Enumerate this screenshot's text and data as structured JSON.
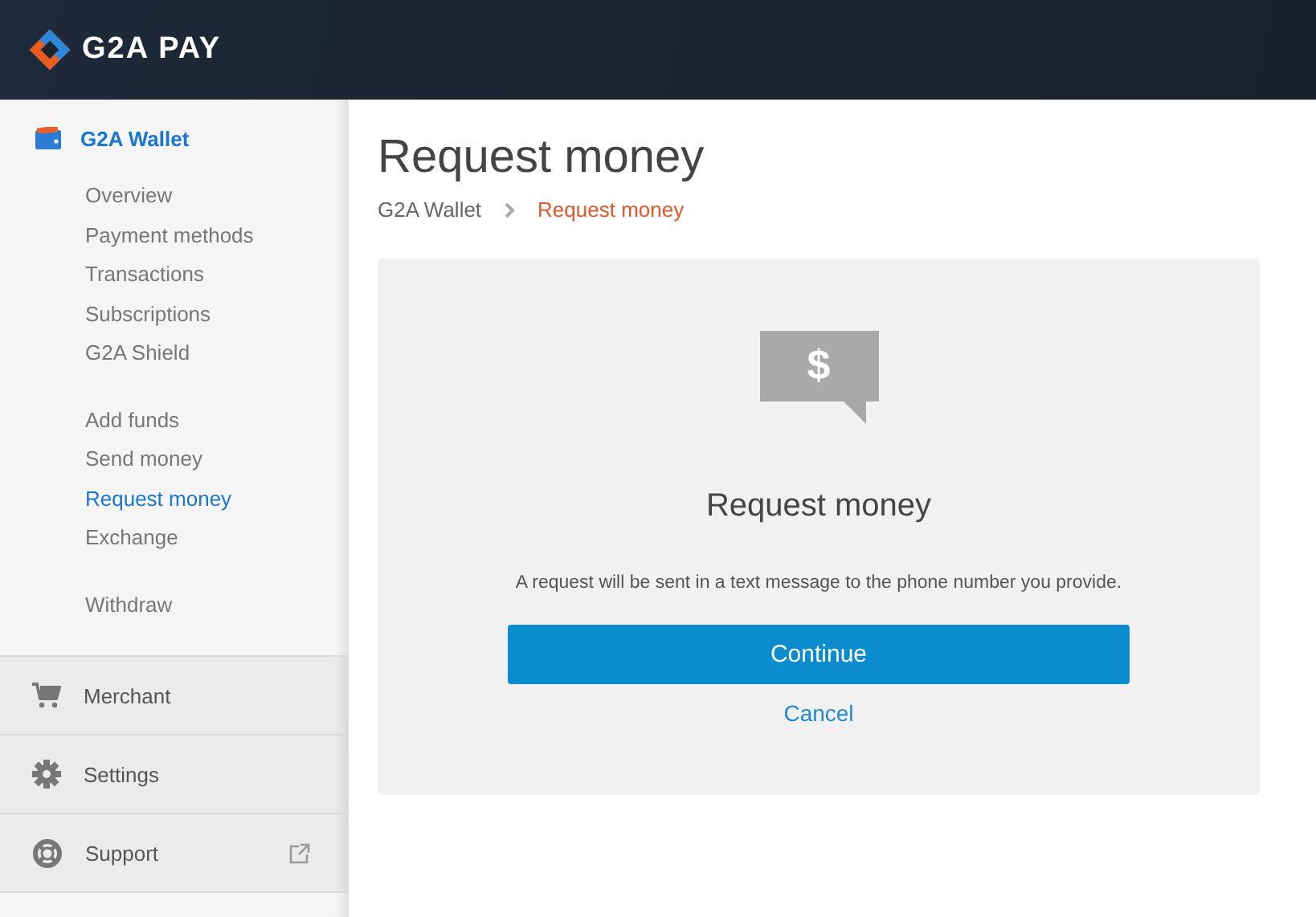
{
  "header": {
    "logo_text": "G2A PAY"
  },
  "sidebar": {
    "wallet": {
      "label": "G2A Wallet",
      "expanded": true
    },
    "groups": [
      [
        {
          "label": "Overview",
          "selected": false
        },
        {
          "label": "Payment methods",
          "selected": false
        },
        {
          "label": "Transactions",
          "selected": false
        },
        {
          "label": "Subscriptions",
          "selected": false
        },
        {
          "label": "G2A Shield",
          "selected": false
        }
      ],
      [
        {
          "label": "Add funds",
          "selected": false
        },
        {
          "label": "Send money",
          "selected": false
        },
        {
          "label": "Request money",
          "selected": true
        },
        {
          "label": "Exchange",
          "selected": false
        }
      ],
      [
        {
          "label": "Withdraw",
          "selected": false
        }
      ]
    ],
    "sections": [
      {
        "label": "Merchant",
        "kind": "cart",
        "external": false
      },
      {
        "label": "Settings",
        "kind": "gear",
        "external": false
      },
      {
        "label": "Support",
        "kind": "lifebuoy",
        "external": true
      }
    ]
  },
  "page": {
    "title": "Request money",
    "breadcrumb": [
      {
        "label": "G2A Wallet",
        "current": false
      },
      {
        "label": "Request money",
        "current": true
      }
    ]
  },
  "card": {
    "icon_glyph": "$",
    "heading": "Request money",
    "text": "A request will be sent in a text message to the phone number you provide.",
    "primary_button": "Continue",
    "secondary_link": "Cancel"
  }
}
